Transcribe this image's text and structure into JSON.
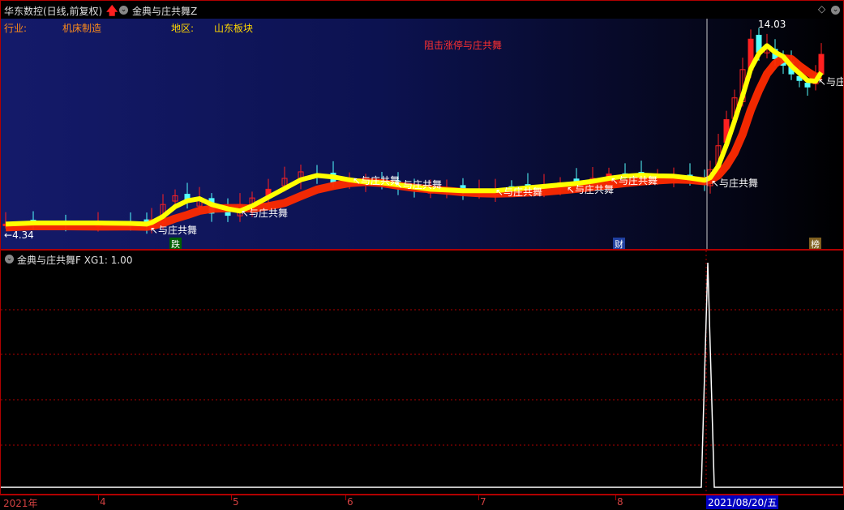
{
  "main": {
    "stock_title": "华东数控(日线,前复权)",
    "indicator_name": "金典与庄共舞Z",
    "industry_label": "行业:",
    "industry_value": "机床制造",
    "region_label": "地区:",
    "region_value": "山东板块",
    "banner": "阻击涨停与庄共舞",
    "low_price": "4.34",
    "high_price": "14.03",
    "signal_text": "与庄共舞",
    "event_markers": [
      "跌",
      "财",
      "榜"
    ]
  },
  "sub": {
    "indicator_header": "金典与庄共舞F  XG1: 1.00"
  },
  "time_axis": {
    "labels": [
      "2021年",
      "4",
      "5",
      "6",
      "7",
      "8"
    ],
    "cursor_date": "2021/08/20/五"
  },
  "colors": {
    "border": "#b00000",
    "up_candle": "#ff2020",
    "down_candle": "#54ffff",
    "fast_line": "#ffff00",
    "slow_line": "#ff2a00",
    "banner": "#ff3030",
    "label_orange": "#ff8c1a",
    "label_yellow": "#ffd700"
  }
}
